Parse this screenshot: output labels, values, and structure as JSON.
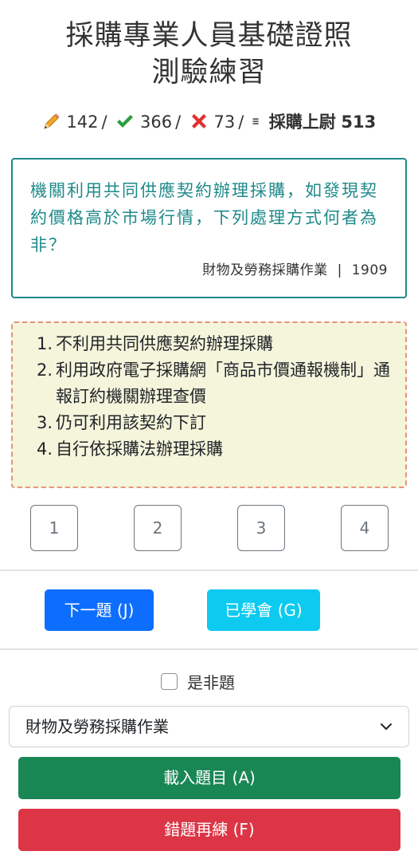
{
  "title": {
    "line1": "採購專業人員基礎證照",
    "line2": "測驗練習"
  },
  "stats": {
    "attempted": "142",
    "correct": "366",
    "wrong": "73",
    "rank": "採購上尉",
    "score": "513",
    "separator": "/",
    "icons": [
      "pencil-icon",
      "check-icon",
      "cross-icon",
      "menu-icon"
    ]
  },
  "question": {
    "text": "機關利用共同供應契約辦理採購，如發現契約價格高於市場行情，下列處理方式何者為非？",
    "category": "財物及勞務採購作業",
    "divider": "|",
    "number": "1909"
  },
  "options": [
    {
      "num": "1.",
      "text": "不利用共同供應契約辦理採購"
    },
    {
      "num": "2.",
      "text": "利用政府電子採購網「商品市價通報機制」通報訂約機關辦理查價"
    },
    {
      "num": "3.",
      "text": "仍可利用該契約下訂"
    },
    {
      "num": "4.",
      "text": "自行依採購法辦理採購"
    }
  ],
  "answers": [
    "1",
    "2",
    "3",
    "4"
  ],
  "actions": {
    "next": "下一題 (J)",
    "learned": "已學會 (G)"
  },
  "true_false_label": "是非題",
  "category_select": {
    "value": "財物及勞務採購作業"
  },
  "load_button": "載入題目 (A)",
  "retry_button": "錯題再練 (F)",
  "colors": {
    "question_border": "#1f8a8a",
    "options_bg": "#f5f5dc",
    "options_border": "#e8927c",
    "primary": "#0d6efd",
    "info": "#0dcaf0",
    "success": "#198754",
    "danger": "#dc3545"
  }
}
